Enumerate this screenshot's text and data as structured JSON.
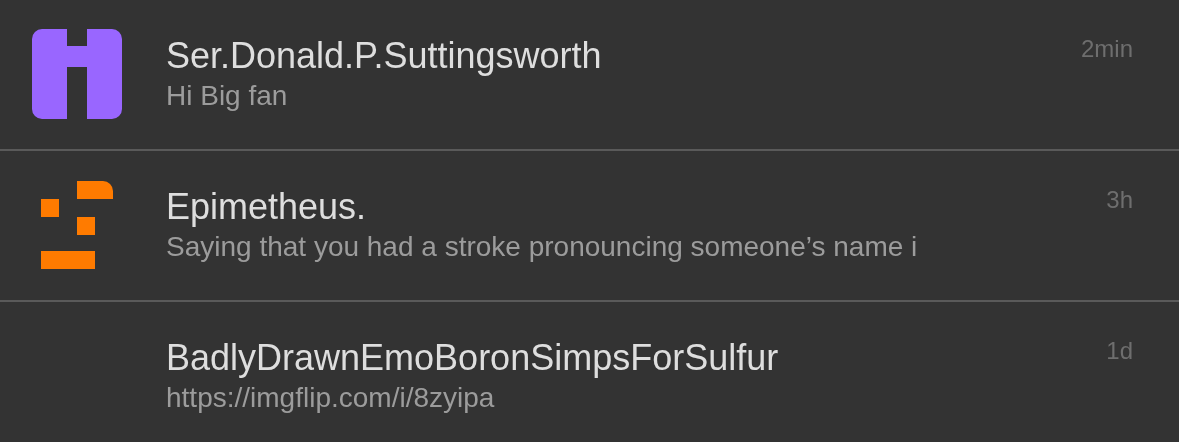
{
  "messages": [
    {
      "kind": "h-logo",
      "name": "Ser.Donald.P.Suttingsworth",
      "preview": "Hi Big fan",
      "time": "2min"
    },
    {
      "kind": "blocks-logo",
      "name": "Epimetheus.",
      "preview": "Saying that you had a stroke pronouncing someone’s name i",
      "time": "3h"
    },
    {
      "kind": "plain",
      "name": "BadlyDrawnEmoBoronSimpsForSulfur",
      "preview": "https://imgflip.com/i/8zyipa",
      "time": "1d"
    }
  ]
}
